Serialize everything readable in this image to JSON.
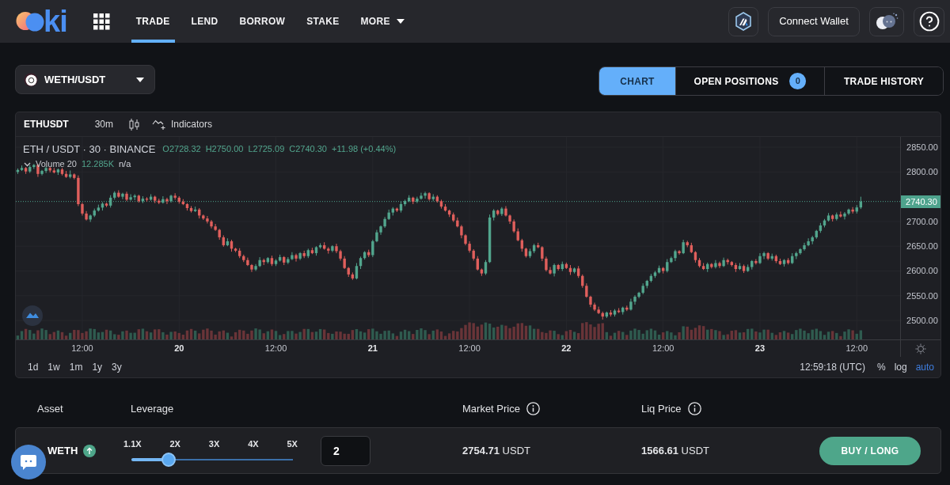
{
  "header": {
    "logo": {
      "text": "ki"
    },
    "nav": [
      {
        "label": "TRADE",
        "kind": "link",
        "selected": true
      },
      {
        "label": "LEND",
        "kind": "link",
        "selected": false
      },
      {
        "label": "BORROW",
        "kind": "link",
        "selected": false
      },
      {
        "label": "STAKE",
        "kind": "link",
        "selected": false
      },
      {
        "label": "MORE",
        "kind": "dropdown",
        "selected": false
      }
    ],
    "connect_button": "Connect Wallet"
  },
  "pair_selector": {
    "value": "WETH/USDT"
  },
  "view_tabs": [
    {
      "label": "CHART",
      "selected": true
    },
    {
      "label": "OPEN POSITIONS",
      "selected": false,
      "badge": "0"
    },
    {
      "label": "TRADE HISTORY",
      "selected": false
    }
  ],
  "chart": {
    "toolbar": {
      "symbol": "ETHUSDT",
      "interval": "30m",
      "indicators": "Indicators"
    },
    "legend": {
      "title": "ETH / USDT · 30 · BINANCE",
      "open": "O2728.32",
      "high": "H2750.00",
      "low": "L2725.09",
      "close": "C2740.30",
      "change": "+11.98 (+0.44%)"
    },
    "volume": {
      "label": "Volume 20",
      "value": "12.285K",
      "extra": "n/a"
    },
    "time_labels_bold": [
      false,
      true,
      false,
      true,
      false,
      true,
      false,
      true,
      false
    ],
    "chart_data": {
      "type": "candlestick",
      "ylim": [
        2461.8,
        2870.8
      ],
      "yticks": [
        {
          "value": 2850,
          "label": "2850.00"
        },
        {
          "value": 2800,
          "label": "2800.00"
        },
        {
          "value": 2700,
          "label": "2700.00"
        },
        {
          "value": 2650,
          "label": "2650.00"
        },
        {
          "value": 2600,
          "label": "2600.00"
        },
        {
          "value": 2550,
          "label": "2550.00"
        },
        {
          "value": 2500,
          "label": "2500.00"
        }
      ],
      "ref_lines": [
        {
          "axis": "y",
          "value": 2740.3,
          "label": "2740.30"
        }
      ],
      "categories": [
        null,
        null,
        null,
        null,
        null,
        null,
        null,
        null,
        null,
        null,
        null,
        null,
        null,
        null,
        null,
        null,
        "12:00",
        null,
        null,
        null,
        null,
        null,
        null,
        null,
        null,
        null,
        null,
        null,
        null,
        null,
        null,
        null,
        null,
        null,
        null,
        null,
        null,
        null,
        null,
        null,
        "20",
        null,
        null,
        null,
        null,
        null,
        null,
        null,
        null,
        null,
        null,
        null,
        null,
        null,
        null,
        null,
        null,
        null,
        null,
        null,
        null,
        null,
        null,
        null,
        "12:00",
        null,
        null,
        null,
        null,
        null,
        null,
        null,
        null,
        null,
        null,
        null,
        null,
        null,
        null,
        null,
        null,
        null,
        null,
        null,
        null,
        null,
        null,
        null,
        "21",
        null,
        null,
        null,
        null,
        null,
        null,
        null,
        null,
        null,
        null,
        null,
        null,
        null,
        null,
        null,
        null,
        null,
        null,
        null,
        null,
        null,
        null,
        null,
        "12:00",
        null,
        null,
        null,
        null,
        null,
        null,
        null,
        null,
        null,
        null,
        null,
        null,
        null,
        null,
        null,
        null,
        null,
        null,
        null,
        null,
        null,
        null,
        null,
        "22",
        null,
        null,
        null,
        null,
        null,
        null,
        null,
        null,
        null,
        null,
        null,
        null,
        null,
        null,
        null,
        null,
        null,
        null,
        null,
        null,
        null,
        null,
        null,
        "12:00",
        null,
        null,
        null,
        null,
        null,
        null,
        null,
        null,
        null,
        null,
        null,
        null,
        null,
        null,
        null,
        null,
        null,
        null,
        null,
        null,
        null,
        null,
        null,
        "23",
        null,
        null,
        null,
        null,
        null,
        null,
        null,
        null,
        null,
        null,
        null,
        null,
        null,
        null,
        null,
        null,
        null,
        null,
        null,
        null,
        null,
        null,
        null,
        "12:00",
        null
      ],
      "ohlc": [
        [
          2800,
          2807,
          2796,
          2804
        ],
        [
          2804,
          2813,
          2802,
          2808
        ],
        [
          2808,
          2810,
          2796,
          2801
        ],
        [
          2801,
          2814,
          2798,
          2810
        ],
        [
          2810,
          2816,
          2806,
          2814
        ],
        [
          2814,
          2816,
          2790,
          2796
        ],
        [
          2796,
          2804,
          2793,
          2802
        ],
        [
          2802,
          2811,
          2798,
          2808
        ],
        [
          2808,
          2810,
          2799,
          2803
        ],
        [
          2803,
          2808,
          2797,
          2799
        ],
        [
          2799,
          2807,
          2794,
          2805
        ],
        [
          2805,
          2808,
          2793,
          2796
        ],
        [
          2796,
          2802,
          2788,
          2790
        ],
        [
          2790,
          2803,
          2787,
          2795
        ],
        [
          2795,
          2797,
          2785,
          2788
        ],
        [
          2788,
          2793,
          2731,
          2735
        ],
        [
          2735,
          2738,
          2712,
          2716
        ],
        [
          2716,
          2721,
          2702,
          2704
        ],
        [
          2704,
          2714,
          2699,
          2712
        ],
        [
          2712,
          2726,
          2709,
          2722
        ],
        [
          2722,
          2734,
          2720,
          2728
        ],
        [
          2728,
          2739,
          2722,
          2736
        ],
        [
          2736,
          2738,
          2729,
          2732
        ],
        [
          2732,
          2753,
          2728,
          2748
        ],
        [
          2748,
          2761,
          2744,
          2758
        ],
        [
          2758,
          2763,
          2748,
          2750
        ],
        [
          2750,
          2758,
          2745,
          2756
        ],
        [
          2756,
          2760,
          2741,
          2744
        ],
        [
          2744,
          2755,
          2742,
          2749
        ],
        [
          2749,
          2755,
          2743,
          2752
        ],
        [
          2752,
          2754,
          2738,
          2741
        ],
        [
          2741,
          2751,
          2737,
          2746
        ],
        [
          2746,
          2749,
          2740,
          2744
        ],
        [
          2744,
          2755,
          2742,
          2750
        ],
        [
          2750,
          2752,
          2737,
          2742
        ],
        [
          2742,
          2746,
          2735,
          2738
        ],
        [
          2738,
          2751,
          2736,
          2745
        ],
        [
          2745,
          2748,
          2735,
          2741
        ],
        [
          2741,
          2754,
          2738,
          2752
        ],
        [
          2752,
          2757,
          2744,
          2748
        ],
        [
          2748,
          2751,
          2736,
          2740
        ],
        [
          2740,
          2745,
          2733,
          2735
        ],
        [
          2735,
          2737,
          2722,
          2727
        ],
        [
          2727,
          2731,
          2718,
          2721
        ],
        [
          2721,
          2730,
          2719,
          2724
        ],
        [
          2724,
          2727,
          2706,
          2712
        ],
        [
          2712,
          2714,
          2703,
          2706
        ],
        [
          2706,
          2711,
          2696,
          2700
        ],
        [
          2700,
          2703,
          2686,
          2690
        ],
        [
          2690,
          2695,
          2681,
          2683
        ],
        [
          2683,
          2685,
          2663,
          2668
        ],
        [
          2668,
          2672,
          2649,
          2652
        ],
        [
          2652,
          2666,
          2650,
          2660
        ],
        [
          2660,
          2663,
          2639,
          2645
        ],
        [
          2645,
          2647,
          2638,
          2641
        ],
        [
          2641,
          2646,
          2626,
          2630
        ],
        [
          2630,
          2633,
          2618,
          2622
        ],
        [
          2622,
          2627,
          2610,
          2612
        ],
        [
          2612,
          2614,
          2598,
          2603
        ],
        [
          2603,
          2614,
          2600,
          2610
        ],
        [
          2610,
          2628,
          2608,
          2622
        ],
        [
          2622,
          2625,
          2612,
          2618
        ],
        [
          2618,
          2628,
          2615,
          2626
        ],
        [
          2626,
          2631,
          2610,
          2614
        ],
        [
          2614,
          2624,
          2610,
          2621
        ],
        [
          2621,
          2633,
          2619,
          2628
        ],
        [
          2628,
          2630,
          2612,
          2617
        ],
        [
          2617,
          2628,
          2614,
          2624
        ],
        [
          2624,
          2638,
          2622,
          2632
        ],
        [
          2632,
          2635,
          2619,
          2625
        ],
        [
          2625,
          2638,
          2622,
          2636
        ],
        [
          2636,
          2641,
          2626,
          2630
        ],
        [
          2630,
          2645,
          2626,
          2642
        ],
        [
          2642,
          2647,
          2634,
          2636
        ],
        [
          2636,
          2650,
          2631,
          2648
        ],
        [
          2648,
          2656,
          2645,
          2652
        ],
        [
          2652,
          2658,
          2643,
          2645
        ],
        [
          2645,
          2648,
          2635,
          2641
        ],
        [
          2641,
          2652,
          2638,
          2650
        ],
        [
          2650,
          2655,
          2636,
          2640
        ],
        [
          2640,
          2643,
          2621,
          2625
        ],
        [
          2625,
          2630,
          2604,
          2606
        ],
        [
          2606,
          2608,
          2588,
          2593
        ],
        [
          2593,
          2597,
          2582,
          2585
        ],
        [
          2585,
          2616,
          2583,
          2610
        ],
        [
          2610,
          2629,
          2604,
          2626
        ],
        [
          2626,
          2640,
          2623,
          2638
        ],
        [
          2638,
          2643,
          2628,
          2632
        ],
        [
          2632,
          2663,
          2628,
          2660
        ],
        [
          2660,
          2683,
          2658,
          2678
        ],
        [
          2678,
          2692,
          2673,
          2690
        ],
        [
          2690,
          2709,
          2687,
          2705
        ],
        [
          2705,
          2724,
          2703,
          2718
        ],
        [
          2718,
          2729,
          2712,
          2726
        ],
        [
          2726,
          2728,
          2719,
          2722
        ],
        [
          2722,
          2740,
          2718,
          2735
        ],
        [
          2735,
          2744,
          2731,
          2741
        ],
        [
          2741,
          2753,
          2739,
          2748
        ],
        [
          2748,
          2750,
          2735,
          2740
        ],
        [
          2740,
          2750,
          2737,
          2746
        ],
        [
          2746,
          2758,
          2744,
          2752
        ],
        [
          2752,
          2760,
          2746,
          2757
        ],
        [
          2757,
          2759,
          2742,
          2745
        ],
        [
          2745,
          2755,
          2741,
          2750
        ],
        [
          2750,
          2753,
          2738,
          2741
        ],
        [
          2741,
          2744,
          2726,
          2730
        ],
        [
          2730,
          2735,
          2720,
          2722
        ],
        [
          2722,
          2724,
          2709,
          2714
        ],
        [
          2714,
          2718,
          2699,
          2702
        ],
        [
          2702,
          2708,
          2688,
          2690
        ],
        [
          2690,
          2693,
          2666,
          2672
        ],
        [
          2672,
          2674,
          2652,
          2655
        ],
        [
          2655,
          2660,
          2637,
          2641
        ],
        [
          2641,
          2644,
          2621,
          2625
        ],
        [
          2625,
          2630,
          2601,
          2603
        ],
        [
          2603,
          2605,
          2590,
          2595
        ],
        [
          2595,
          2622,
          2592,
          2618
        ],
        [
          2618,
          2714,
          2616,
          2708
        ],
        [
          2708,
          2725,
          2702,
          2722
        ],
        [
          2722,
          2724,
          2712,
          2715
        ],
        [
          2715,
          2729,
          2711,
          2726
        ],
        [
          2726,
          2731,
          2710,
          2712
        ],
        [
          2712,
          2714,
          2695,
          2700
        ],
        [
          2700,
          2704,
          2677,
          2680
        ],
        [
          2680,
          2686,
          2660,
          2662
        ],
        [
          2662,
          2665,
          2639,
          2645
        ],
        [
          2645,
          2647,
          2627,
          2630
        ],
        [
          2630,
          2645,
          2626,
          2640
        ],
        [
          2640,
          2655,
          2636,
          2652
        ],
        [
          2652,
          2657,
          2646,
          2648
        ],
        [
          2648,
          2650,
          2620,
          2625
        ],
        [
          2625,
          2629,
          2599,
          2602
        ],
        [
          2602,
          2608,
          2593,
          2595
        ],
        [
          2595,
          2615,
          2589,
          2612
        ],
        [
          2612,
          2614,
          2601,
          2604
        ],
        [
          2604,
          2619,
          2600,
          2614
        ],
        [
          2614,
          2617,
          2604,
          2606
        ],
        [
          2606,
          2612,
          2592,
          2598
        ],
        [
          2598,
          2607,
          2595,
          2605
        ],
        [
          2605,
          2610,
          2586,
          2590
        ],
        [
          2590,
          2593,
          2566,
          2570
        ],
        [
          2570,
          2575,
          2546,
          2548
        ],
        [
          2548,
          2550,
          2527,
          2532
        ],
        [
          2532,
          2536,
          2519,
          2522
        ],
        [
          2522,
          2528,
          2513,
          2515
        ],
        [
          2515,
          2518,
          2502,
          2508
        ],
        [
          2508,
          2518,
          2505,
          2516
        ],
        [
          2516,
          2521,
          2508,
          2512
        ],
        [
          2512,
          2523,
          2508,
          2520
        ],
        [
          2520,
          2525,
          2515,
          2517
        ],
        [
          2517,
          2528,
          2512,
          2526
        ],
        [
          2526,
          2530,
          2519,
          2522
        ],
        [
          2522,
          2544,
          2520,
          2538
        ],
        [
          2538,
          2551,
          2532,
          2548
        ],
        [
          2548,
          2558,
          2545,
          2556
        ],
        [
          2556,
          2575,
          2553,
          2570
        ],
        [
          2570,
          2582,
          2565,
          2580
        ],
        [
          2580,
          2594,
          2577,
          2590
        ],
        [
          2590,
          2600,
          2586,
          2597
        ],
        [
          2597,
          2611,
          2595,
          2606
        ],
        [
          2606,
          2608,
          2595,
          2600
        ],
        [
          2600,
          2624,
          2597,
          2618
        ],
        [
          2618,
          2629,
          2616,
          2626
        ],
        [
          2626,
          2643,
          2620,
          2640
        ],
        [
          2640,
          2642,
          2633,
          2636
        ],
        [
          2636,
          2663,
          2634,
          2658
        ],
        [
          2658,
          2661,
          2648,
          2652
        ],
        [
          2652,
          2657,
          2636,
          2638
        ],
        [
          2638,
          2640,
          2617,
          2622
        ],
        [
          2622,
          2626,
          2607,
          2610
        ],
        [
          2610,
          2616,
          2602,
          2604
        ],
        [
          2604,
          2617,
          2598,
          2614
        ],
        [
          2614,
          2616,
          2605,
          2608
        ],
        [
          2608,
          2622,
          2605,
          2616
        ],
        [
          2616,
          2619,
          2606,
          2610
        ],
        [
          2610,
          2627,
          2608,
          2622
        ],
        [
          2622,
          2625,
          2613,
          2618
        ],
        [
          2618,
          2620,
          2609,
          2612
        ],
        [
          2612,
          2616,
          2598,
          2604
        ],
        [
          2604,
          2616,
          2602,
          2610
        ],
        [
          2610,
          2613,
          2596,
          2600
        ],
        [
          2600,
          2613,
          2598,
          2608
        ],
        [
          2608,
          2622,
          2603,
          2620
        ],
        [
          2620,
          2624,
          2613,
          2616
        ],
        [
          2616,
          2636,
          2614,
          2630
        ],
        [
          2630,
          2639,
          2624,
          2636
        ],
        [
          2636,
          2638,
          2622,
          2625
        ],
        [
          2625,
          2635,
          2621,
          2630
        ],
        [
          2630,
          2633,
          2616,
          2620
        ],
        [
          2620,
          2625,
          2612,
          2614
        ],
        [
          2614,
          2624,
          2609,
          2622
        ],
        [
          2622,
          2626,
          2613,
          2616
        ],
        [
          2616,
          2636,
          2614,
          2630
        ],
        [
          2630,
          2639,
          2624,
          2636
        ],
        [
          2636,
          2646,
          2633,
          2644
        ],
        [
          2644,
          2657,
          2641,
          2652
        ],
        [
          2652,
          2666,
          2650,
          2660
        ],
        [
          2660,
          2671,
          2654,
          2668
        ],
        [
          2668,
          2683,
          2665,
          2681
        ],
        [
          2681,
          2697,
          2677,
          2692
        ],
        [
          2692,
          2705,
          2688,
          2702
        ],
        [
          2702,
          2717,
          2700,
          2712
        ],
        [
          2712,
          2714,
          2700,
          2705
        ],
        [
          2705,
          2718,
          2702,
          2714
        ],
        [
          2714,
          2720,
          2708,
          2710
        ],
        [
          2710,
          2719,
          2704,
          2716
        ],
        [
          2716,
          2726,
          2713,
          2724
        ],
        [
          2724,
          2729,
          2716,
          2720
        ],
        [
          2720,
          2733,
          2716,
          2728.32
        ],
        [
          2728.32,
          2750,
          2725.09,
          2740.3
        ]
      ]
    },
    "ranges": [
      "1d",
      "1w",
      "1m",
      "1y",
      "3y"
    ],
    "clock": "12:59:18 (UTC)",
    "scale_options": [
      {
        "label": "%",
        "selected": false
      },
      {
        "label": "log",
        "selected": false
      },
      {
        "label": "auto",
        "selected": true
      }
    ]
  },
  "order": {
    "columns": [
      {
        "label": "Asset",
        "info": false
      },
      {
        "label": "Leverage",
        "info": false
      },
      {
        "label": "Market Price",
        "info": true
      },
      {
        "label": "Liq Price",
        "info": true
      }
    ],
    "asset": "WETH",
    "leverage": {
      "options": [
        "1.1X",
        "2X",
        "3X",
        "4X",
        "5X"
      ],
      "level": 0.23,
      "value": "2"
    },
    "market_price": "**2754.71** USDT",
    "liq_price": "**1566.61** USDT",
    "action": "BUY / LONG"
  }
}
